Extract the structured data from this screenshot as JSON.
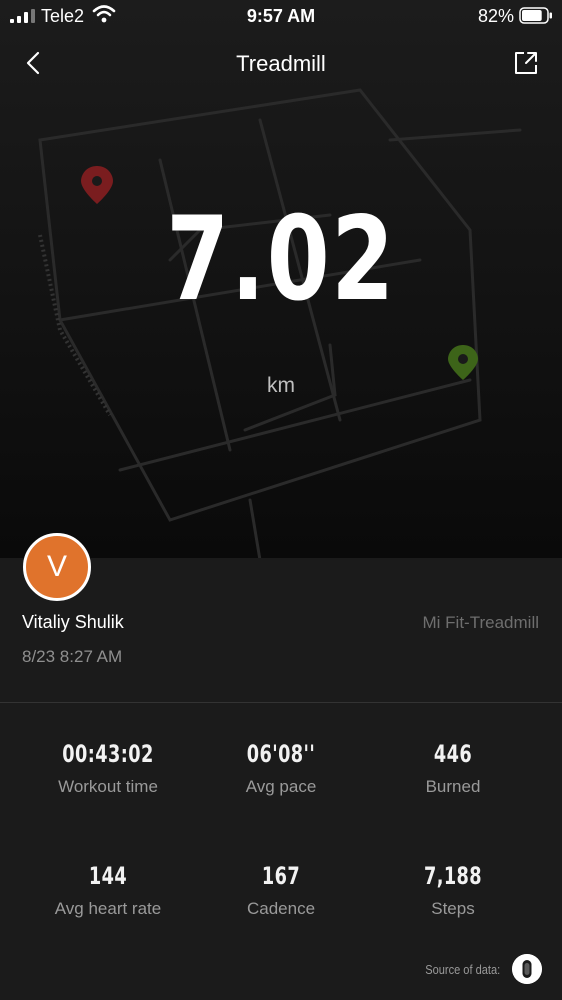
{
  "status_bar": {
    "carrier": "Tele2",
    "time": "9:57 AM",
    "battery_percent": "82%",
    "battery_level": 0.82,
    "icons": [
      "signal-bars-icon",
      "wifi-icon",
      "battery-icon"
    ]
  },
  "nav": {
    "title": "Treadmill",
    "back_icon": "chevron-left-icon",
    "share_icon": "share-external-icon"
  },
  "distance": {
    "value": "7.02",
    "unit": "km"
  },
  "user": {
    "initial": "V",
    "name": "Vitaliy Shulik",
    "date": "8/23 8:27 AM",
    "source_app": "Mi Fit-Treadmill"
  },
  "stats": {
    "workout_time": {
      "value": "00:43:02",
      "label": "Workout time"
    },
    "avg_pace": {
      "value": "06'08''",
      "label": "Avg pace"
    },
    "burned": {
      "value": "446",
      "label": "Burned"
    },
    "avg_heart_rate": {
      "value": "144",
      "label": "Avg heart rate"
    },
    "cadence": {
      "value": "167",
      "label": "Cadence"
    },
    "steps": {
      "value": "7,188",
      "label": "Steps"
    }
  },
  "footer": {
    "source_label": "Source of data:",
    "device_icon": "mi-band-icon"
  },
  "colors": {
    "background": "#1b1b1b",
    "avatar": "#e0732c",
    "start_pin": "#8a2020",
    "end_pin": "#3f6b1a"
  }
}
